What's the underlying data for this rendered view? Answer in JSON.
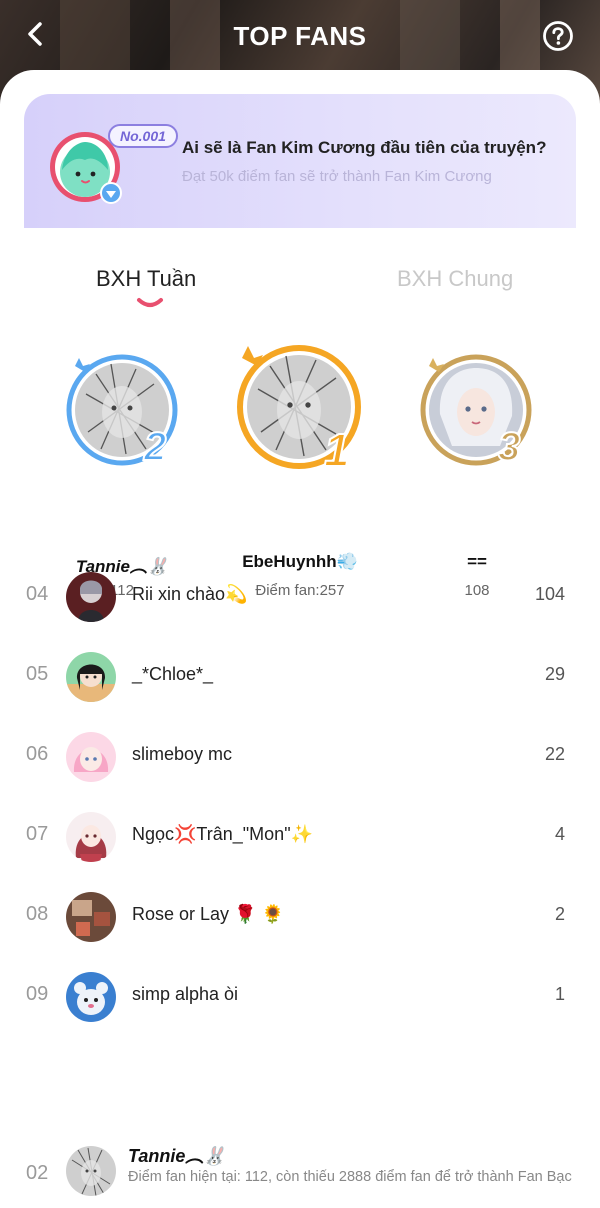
{
  "header": {
    "title": "TOP FANS"
  },
  "banner": {
    "badge": "No.001",
    "title": "Ai sẽ là Fan Kim Cương đầu tiên của truyện?",
    "subtitle": "Đạt 50k điểm fan sẽ trở thành Fan Kim Cương"
  },
  "tabs": [
    {
      "label": "BXH Tuần",
      "active": true
    },
    {
      "label": "BXH Chung",
      "active": false
    }
  ],
  "podium": [
    {
      "rank": "2",
      "name": "Tannie︵🐰",
      "score": "112",
      "ring_color": "#5aa8f0"
    },
    {
      "rank": "1",
      "name": "EbeHuynhh💨",
      "score": "Điểm fan:257",
      "ring_color": "#f5a623"
    },
    {
      "rank": "3",
      "name": "==",
      "score": "108",
      "ring_color": "#c9a25a"
    }
  ],
  "list": [
    {
      "rank": "04",
      "name": "Rii xin chào💫",
      "score": "104"
    },
    {
      "rank": "05",
      "name": "_*Chloe*_",
      "score": "29"
    },
    {
      "rank": "06",
      "name": "slimeboy mc",
      "score": "22"
    },
    {
      "rank": "07",
      "name": "Ngọc💢Trân_\"Mon\"✨",
      "score": "4"
    },
    {
      "rank": "08",
      "name": "Rose or Lay 🌹 🌻",
      "score": "2"
    },
    {
      "rank": "09",
      "name": "simp alpha òi",
      "score": "1"
    }
  ],
  "me": {
    "rank": "02",
    "name": "Tannie︵🐰",
    "desc": "Điểm fan hiện tại: 112, còn thiếu 2888 điểm fan để trở thành Fan Bạc"
  },
  "colors": {
    "accent": "#e8506f",
    "banner_purple": "#d6d0fa",
    "gold": "#f5a623",
    "blue": "#5aa8f0"
  }
}
